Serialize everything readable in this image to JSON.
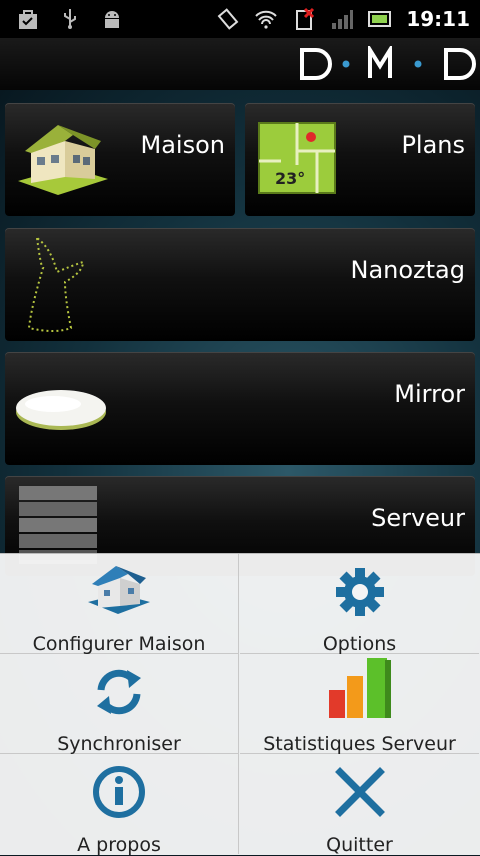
{
  "status_bar": {
    "time": "19:11"
  },
  "app_bar": {
    "logo_text": "D·M·D"
  },
  "tiles": [
    {
      "label": "Maison"
    },
    {
      "label": "Plans",
      "plan_temperature": "23°"
    },
    {
      "label": "Nanoztag"
    },
    {
      "label": "Mirror"
    },
    {
      "label": "Serveur"
    }
  ],
  "menu": [
    {
      "label": "Configurer Maison",
      "icon": "house-config-icon"
    },
    {
      "label": "Options",
      "icon": "gear-icon"
    },
    {
      "label": "Synchroniser",
      "icon": "sync-icon"
    },
    {
      "label": "Statistiques Serveur",
      "icon": "bar-stats-icon"
    },
    {
      "label": "A propos",
      "icon": "info-icon"
    },
    {
      "label": "Quitter",
      "icon": "close-icon"
    }
  ],
  "colors": {
    "accent_blue": "#1e6fa0",
    "plan_green": "#9ccc3c"
  }
}
